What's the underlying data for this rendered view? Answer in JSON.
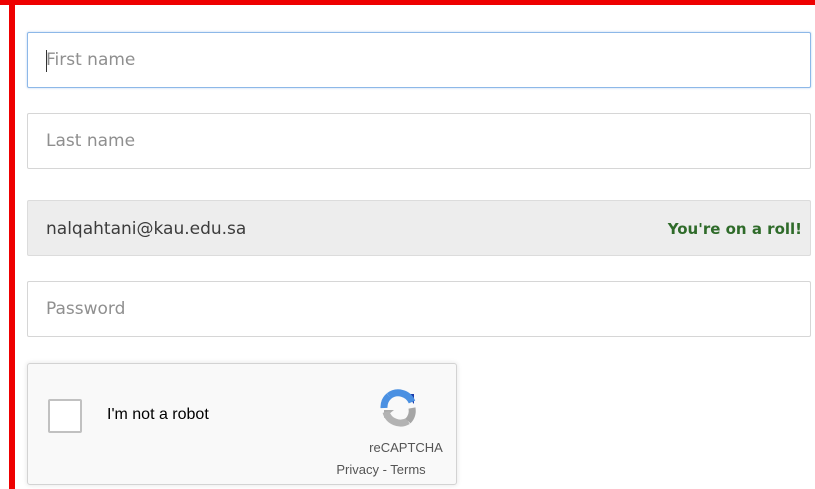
{
  "form": {
    "first_name": {
      "placeholder": "First name",
      "value": ""
    },
    "last_name": {
      "placeholder": "Last name",
      "value": ""
    },
    "email": {
      "value": "nalqahtani@kau.edu.sa",
      "status_message": "You're on a roll!"
    },
    "password": {
      "placeholder": "Password",
      "value": ""
    }
  },
  "recaptcha": {
    "label": "I'm not a robot",
    "brand": "reCAPTCHA",
    "privacy_link": "Privacy",
    "separator": " - ",
    "terms_link": "Terms",
    "checked": false
  },
  "colors": {
    "highlight_frame": "#ee0000",
    "focus_border": "#8db8e8",
    "success_text": "#2f6b2a"
  }
}
